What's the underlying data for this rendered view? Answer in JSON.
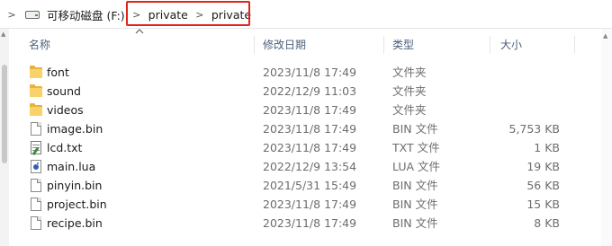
{
  "breadcrumb": {
    "items": [
      "可移动磁盘 (F:)",
      "private",
      "private"
    ],
    "separators": [
      ">",
      ">",
      ">"
    ]
  },
  "columns": {
    "name": "名称",
    "date": "修改日期",
    "type": "类型",
    "size": "大小"
  },
  "files": [
    {
      "name": "font",
      "date": "2023/11/8 17:49",
      "type": "文件夹",
      "size": "",
      "icon": "folder-icon"
    },
    {
      "name": "sound",
      "date": "2022/12/9 11:03",
      "type": "文件夹",
      "size": "",
      "icon": "folder-icon"
    },
    {
      "name": "videos",
      "date": "2023/11/8 17:49",
      "type": "文件夹",
      "size": "",
      "icon": "folder-icon"
    },
    {
      "name": "image.bin",
      "date": "2023/11/8 17:49",
      "type": "BIN 文件",
      "size": "5,753 KB",
      "icon": "file-icon"
    },
    {
      "name": "lcd.txt",
      "date": "2023/11/8 17:49",
      "type": "TXT 文件",
      "size": "1 KB",
      "icon": "text-file-icon"
    },
    {
      "name": "main.lua",
      "date": "2022/12/9 13:54",
      "type": "LUA 文件",
      "size": "19 KB",
      "icon": "lua-file-icon"
    },
    {
      "name": "pinyin.bin",
      "date": "2021/5/31 15:49",
      "type": "BIN 文件",
      "size": "56 KB",
      "icon": "file-icon"
    },
    {
      "name": "project.bin",
      "date": "2023/11/8 17:49",
      "type": "BIN 文件",
      "size": "15 KB",
      "icon": "file-icon"
    },
    {
      "name": "recipe.bin",
      "date": "2023/11/8 17:49",
      "type": "BIN 文件",
      "size": "8 KB",
      "icon": "file-icon"
    }
  ],
  "colors": {
    "highlight_box": "#e0241b",
    "folder": "#f9d26b",
    "header_text": "#4c607a"
  }
}
